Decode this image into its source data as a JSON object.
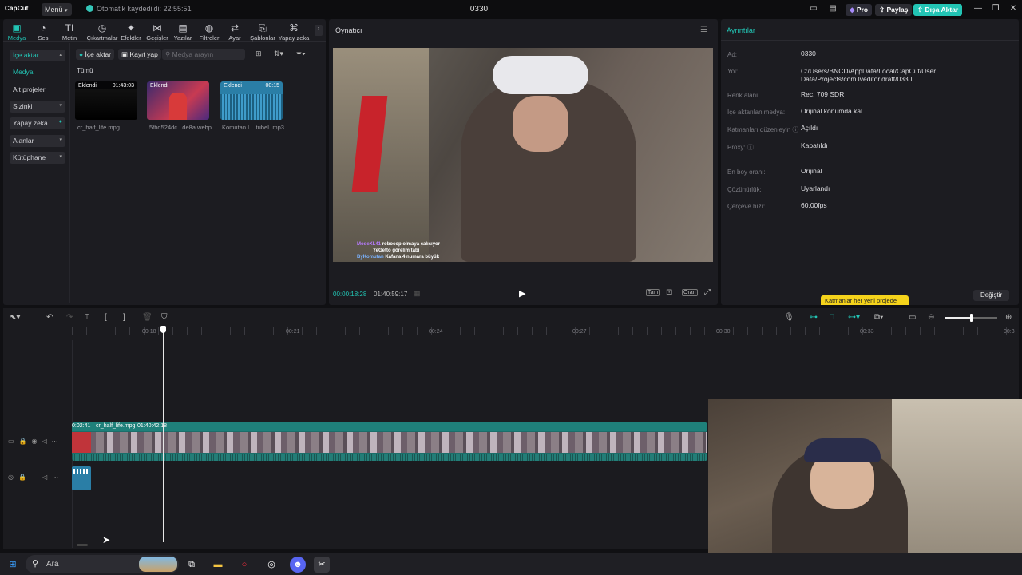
{
  "app": {
    "logo": "CapCut",
    "menu_label": "Menü",
    "autosave_text": "Otomatik kaydedildi: 22:55:51",
    "project_title": "0330",
    "pro_label": "Pro",
    "share_label": "Paylaş",
    "export_label": "Dışa Aktar",
    "accent": "#22c4b4"
  },
  "toolbar": {
    "items": [
      {
        "label": "Medya",
        "icon": "media-icon"
      },
      {
        "label": "Ses",
        "icon": "audio-icon"
      },
      {
        "label": "Metin",
        "icon": "text-icon"
      },
      {
        "label": "Çıkartmalar",
        "icon": "sticker-icon"
      },
      {
        "label": "Efektler",
        "icon": "effects-icon"
      },
      {
        "label": "Geçişler",
        "icon": "transitions-icon"
      },
      {
        "label": "Yazılar",
        "icon": "captions-icon"
      },
      {
        "label": "Filtreler",
        "icon": "filters-icon"
      },
      {
        "label": "Ayar",
        "icon": "adjust-icon"
      },
      {
        "label": "Şablonlar",
        "icon": "templates-icon"
      },
      {
        "label": "Yapay zeka",
        "icon": "ai-icon"
      }
    ]
  },
  "sidebar": {
    "items": [
      {
        "label": "İçe aktar"
      },
      {
        "label": "Medya"
      },
      {
        "label": "Alt projeler"
      },
      {
        "label": "Sizinki"
      },
      {
        "label": "Yapay zeka ..."
      },
      {
        "label": "Alanlar"
      },
      {
        "label": "Kütüphane"
      }
    ]
  },
  "media": {
    "import_label": "İçe aktar",
    "record_label": "Kayıt yap",
    "search_placeholder": "Medya arayın",
    "filter_all": "Tümü",
    "files": [
      {
        "tag": "Eklendi",
        "duration": "01:43:03",
        "name": "cr_half_life.mpg"
      },
      {
        "tag": "Eklendi",
        "duration": "",
        "name": "5fbd524dc...de8a.webp"
      },
      {
        "tag": "Eklendi",
        "duration": "00:15",
        "name": "Komutan L...tubeL.mp3"
      }
    ]
  },
  "player": {
    "title": "Oynatıcı",
    "current_time": "00:00:18:28",
    "total_time": "01:40:59:17",
    "full_label": "Tam",
    "ratio_label": "Oran",
    "chat_lines": [
      {
        "user": "ModeXL41",
        "text": "robocop olmaya çalışıyor"
      },
      {
        "user": "",
        "text": "YeGetto görelim tabi"
      },
      {
        "user": "ByKomutan",
        "text": "Kafana 4 numara büyük"
      }
    ]
  },
  "details": {
    "title": "Ayrıntılar",
    "rows": [
      {
        "label": "Ad:",
        "value": "0330"
      },
      {
        "label": "Yol:",
        "value": "C:/Users/BNCD/AppData/Local/CapCut/User Data/Projects/com.lveditor.draft/0330"
      },
      {
        "label": "Renk alanı:",
        "value": "Rec. 709 SDR"
      },
      {
        "label": "İçe aktarılan medya:",
        "value": "Orijinal konumda kal"
      },
      {
        "label": "Katmanları düzenleyin",
        "value": "Açıldı"
      },
      {
        "label": "Proxy:",
        "value": "Kapatıldı"
      },
      {
        "label": "En boy oranı:",
        "value": "Orijinal"
      },
      {
        "label": "Çözünürlük:",
        "value": "Uyarlandı"
      },
      {
        "label": "Çerçeve hızı:",
        "value": "60.00fps"
      }
    ],
    "tooltip": "Katmanlar her yeni projede",
    "change_label": "Değiştir"
  },
  "timeline": {
    "ruler": [
      "00:18",
      "00:21",
      "00:24",
      "00:27",
      "00:30",
      "00:33",
      "00:3"
    ],
    "clip_start": "0:02:41",
    "clip_name": "cr_half_life.mpg",
    "clip_duration": "01:40:42:18"
  },
  "taskbar": {
    "search_placeholder": "Ara"
  }
}
